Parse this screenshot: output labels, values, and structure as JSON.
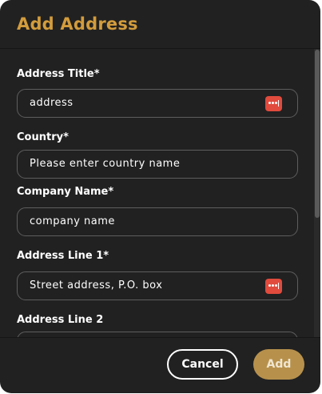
{
  "dialog": {
    "title": "Add Address"
  },
  "form": {
    "fields": [
      {
        "label": "Address Title*",
        "value": "address",
        "has_password_icon": true
      },
      {
        "label": "Country*",
        "value": "Please enter country name",
        "has_password_icon": false
      },
      {
        "label": "Company Name*",
        "value": "company name",
        "has_password_icon": false
      },
      {
        "label": "Address Line 1*",
        "value": "Street address, P.O. box",
        "has_password_icon": true
      },
      {
        "label": "Address Line 2",
        "value": "",
        "has_password_icon": false
      }
    ]
  },
  "footer": {
    "cancel_label": "Cancel",
    "add_label": "Add"
  },
  "colors": {
    "modal_bg": "#212121",
    "accent": "#d39c3c",
    "add_button_bg": "#b7914c",
    "password_icon": "#e04b3d"
  },
  "icons": {
    "password_manager": "password-dots-icon"
  }
}
